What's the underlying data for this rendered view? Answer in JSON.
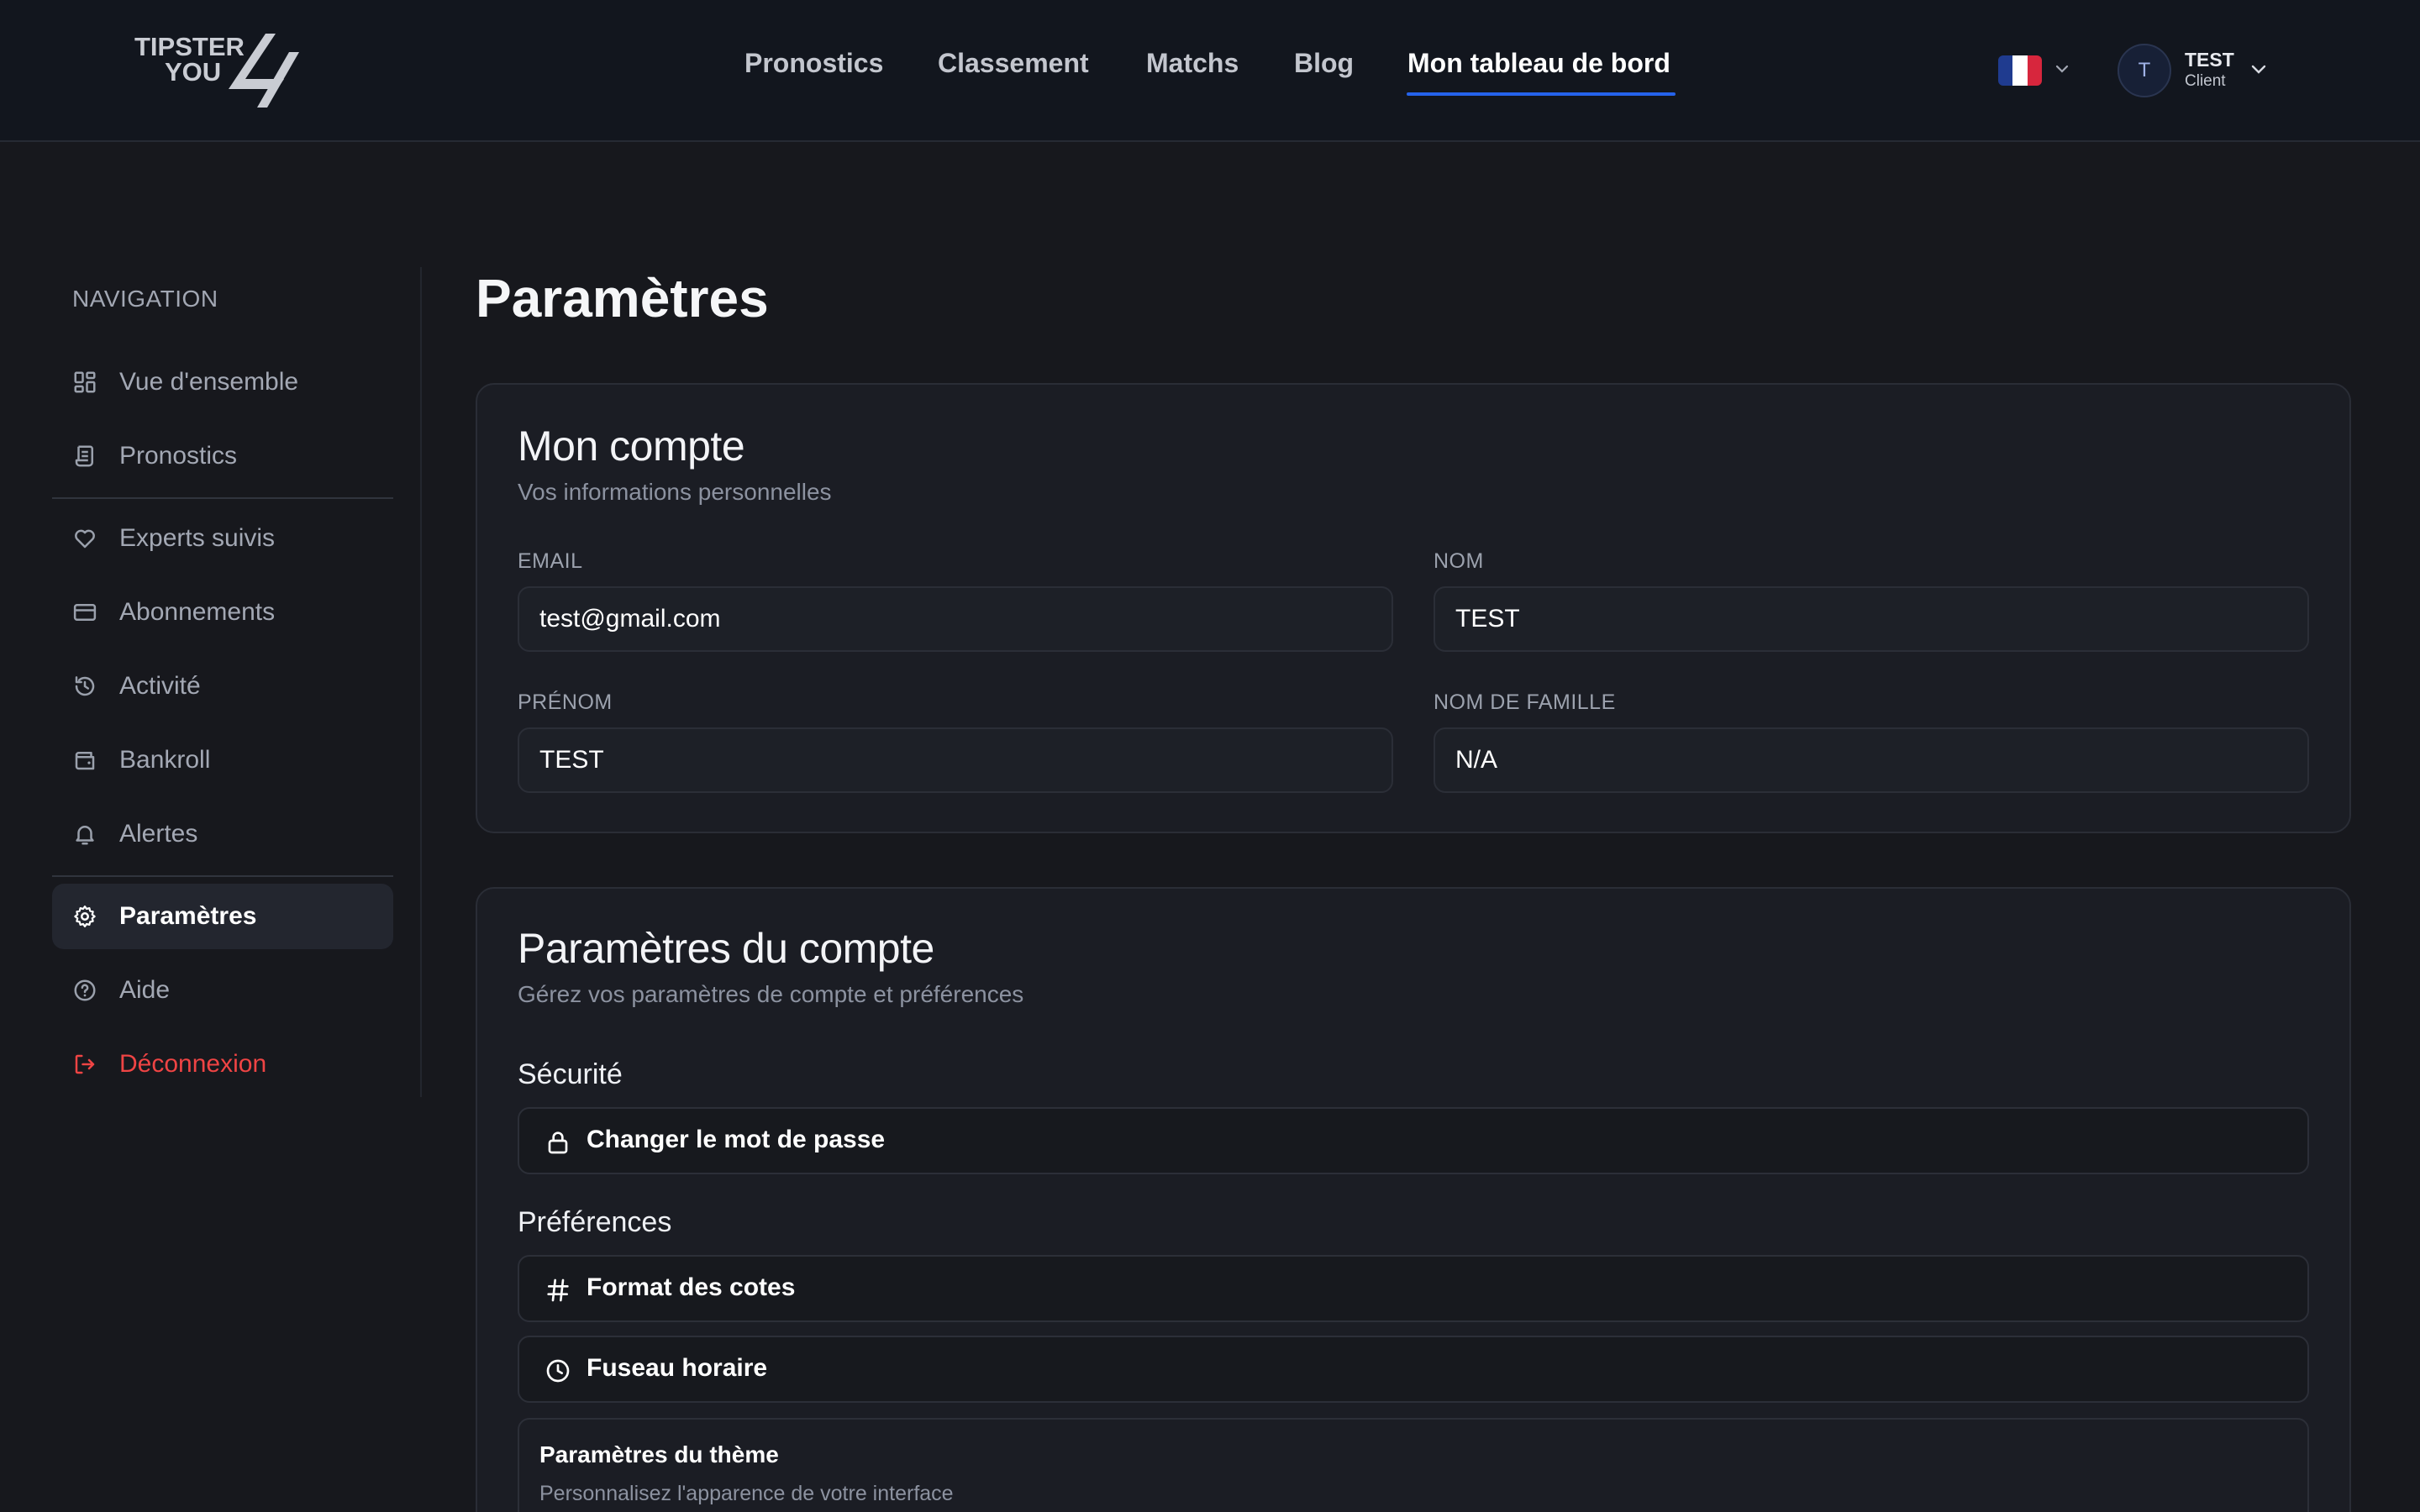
{
  "header": {
    "logo": {
      "line1": "TIPSTER",
      "line2": "YOU"
    },
    "nav": [
      {
        "label": "Pronostics"
      },
      {
        "label": "Classement"
      },
      {
        "label": "Matchs"
      },
      {
        "label": "Blog"
      },
      {
        "label": "Mon tableau de bord",
        "active": true
      }
    ],
    "language": {
      "flag": "fr",
      "colors": [
        "#1f3b8f",
        "#ffffff",
        "#d7263d"
      ]
    },
    "user": {
      "initial": "T",
      "name": "TEST",
      "role": "Client"
    }
  },
  "sidebar": {
    "heading": "NAVIGATION",
    "items": [
      {
        "label": "Vue d'ensemble",
        "icon": "dashboard-icon"
      },
      {
        "label": "Pronostics",
        "icon": "scroll-icon"
      },
      {
        "label": "Experts suivis",
        "icon": "heart-icon"
      },
      {
        "label": "Abonnements",
        "icon": "credit-card-icon"
      },
      {
        "label": "Activité",
        "icon": "history-icon"
      },
      {
        "label": "Bankroll",
        "icon": "wallet-icon"
      },
      {
        "label": "Alertes",
        "icon": "bell-icon"
      },
      {
        "label": "Paramètres",
        "icon": "gear-icon",
        "active": true
      },
      {
        "label": "Aide",
        "icon": "help-circle-icon"
      },
      {
        "label": "Déconnexion",
        "icon": "logout-icon"
      }
    ]
  },
  "main": {
    "title": "Paramètres",
    "account": {
      "title": "Mon compte",
      "subtitle": "Vos informations personnelles",
      "fields": {
        "email": {
          "label": "EMAIL",
          "value": "test@gmail.com"
        },
        "nom": {
          "label": "NOM",
          "value": "TEST"
        },
        "prenom": {
          "label": "PRÉNOM",
          "value": "TEST"
        },
        "nom_famille": {
          "label": "NOM DE FAMILLE",
          "value": "N/A"
        }
      }
    },
    "settings": {
      "title": "Paramètres du compte",
      "subtitle": "Gérez vos paramètres de compte et préférences",
      "security_label": "Sécurité",
      "change_password": "Changer le mot de passe",
      "preferences_label": "Préférences",
      "odds_format": "Format des cotes",
      "timezone": "Fuseau horaire",
      "theme_title": "Paramètres du thème",
      "theme_subtitle": "Personnalisez l'apparence de votre interface"
    }
  },
  "colors": {
    "accent": "#2563eb",
    "danger": "#ef4444",
    "background": "#17181d",
    "header": "#12161e"
  }
}
